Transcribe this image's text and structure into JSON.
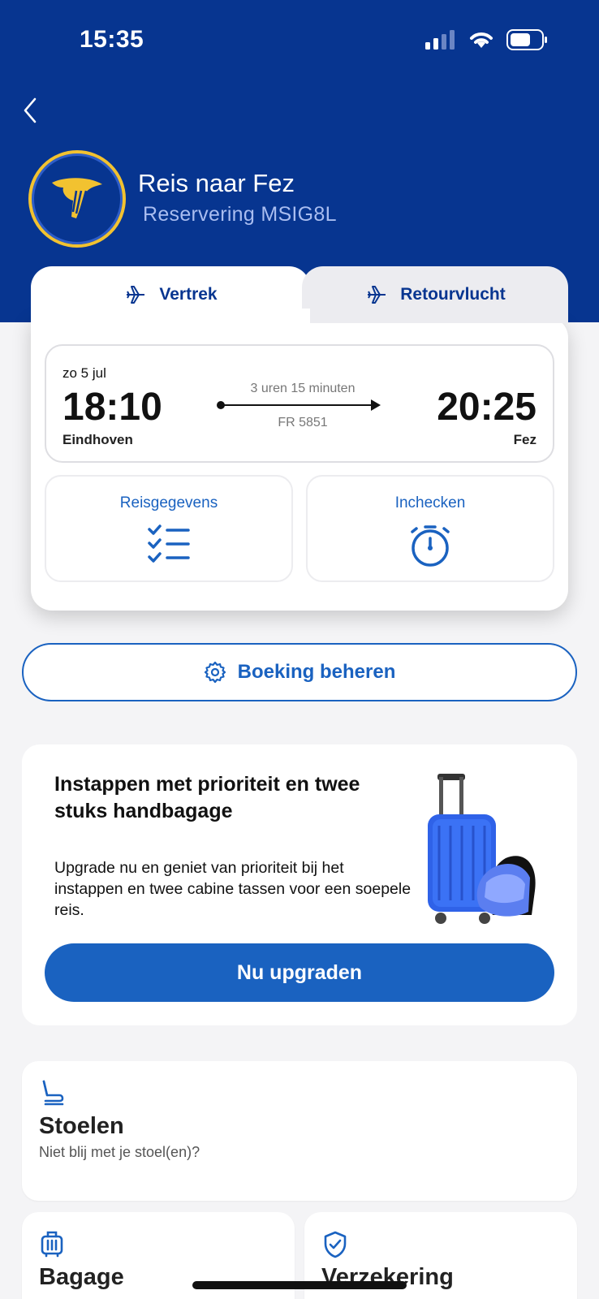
{
  "status": {
    "time": "15:35"
  },
  "header": {
    "title": "Reis naar Fez",
    "subtitle": "Reservering MSIG8L"
  },
  "tabs": [
    {
      "label": "Vertrek",
      "active": true
    },
    {
      "label": "Retourvlucht",
      "active": false
    }
  ],
  "flight": {
    "date": "zo 5 jul",
    "departure_time": "18:10",
    "departure_city": "Eindhoven",
    "arrival_time": "20:25",
    "arrival_city": "Fez",
    "duration": "3 uren 15 minuten",
    "flight_number": "FR 5851"
  },
  "actions": {
    "travel_details": "Reisgegevens",
    "checkin": "Inchecken"
  },
  "manage": {
    "label": "Boeking beheren"
  },
  "promo": {
    "title": "Instappen met prioriteit en twee stuks handbagage",
    "text": "Upgrade nu en geniet van prioriteit bij het instappen en twee cabine tassen voor een soepele reis.",
    "button": "Nu upgraden"
  },
  "tiles": {
    "seats": {
      "title": "Stoelen",
      "subtitle": "Niet blij met je stoel(en)?"
    },
    "bags": {
      "title": "Bagage"
    },
    "insurance": {
      "title": "Verzekering"
    }
  },
  "colors": {
    "brand_blue": "#073590",
    "accent_blue": "#1a62c0",
    "logo_gold": "#f2c230"
  },
  "icons": [
    "back-chevron-icon",
    "plane-icon",
    "checklist-icon",
    "stopwatch-icon",
    "gear-icon",
    "seat-icon",
    "luggage-icon",
    "shield-check-icon"
  ]
}
